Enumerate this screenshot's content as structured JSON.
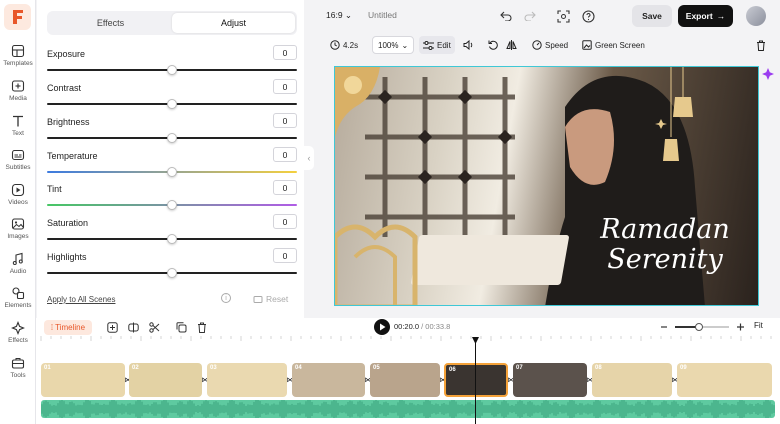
{
  "rail": {
    "items": [
      {
        "label": "Templates",
        "icon": "grid-icon"
      },
      {
        "label": "Media",
        "icon": "media-icon"
      },
      {
        "label": "Text",
        "icon": "text-icon"
      },
      {
        "label": "Subtitles",
        "icon": "subtitles-icon"
      },
      {
        "label": "Videos",
        "icon": "video-icon"
      },
      {
        "label": "Images",
        "icon": "image-icon"
      },
      {
        "label": "Audio",
        "icon": "music-icon"
      },
      {
        "label": "Elements",
        "icon": "shapes-icon"
      },
      {
        "label": "Effects",
        "icon": "sparkle-icon"
      },
      {
        "label": "Tools",
        "icon": "toolbox-icon"
      }
    ]
  },
  "panel": {
    "tabs": [
      "Effects",
      "Adjust"
    ],
    "active_tab": "Adjust",
    "adjustments": [
      {
        "name": "Exposure",
        "value": "0",
        "level": 0.5,
        "track": "#222222"
      },
      {
        "name": "Contrast",
        "value": "0",
        "level": 0.5,
        "track": "#222222"
      },
      {
        "name": "Brightness",
        "value": "0",
        "level": 0.5,
        "track": "#222222"
      },
      {
        "name": "Temperature",
        "value": "0",
        "level": 0.5,
        "track": "gradient-temp"
      },
      {
        "name": "Tint",
        "value": "0",
        "level": 0.5,
        "track": "gradient-tint"
      },
      {
        "name": "Saturation",
        "value": "0",
        "level": 0.5,
        "track": "#222222"
      },
      {
        "name": "Highlights",
        "value": "0",
        "level": 0.5,
        "track": "#222222"
      }
    ],
    "apply_all": "Apply to All Scenes",
    "reset": "Reset"
  },
  "topbar": {
    "ratio": "16:9",
    "title": "Untitled",
    "save": "Save",
    "export": "Export"
  },
  "toolbar": {
    "duration": "4.2s",
    "zoom": "100%",
    "edit": "Edit",
    "speed": "Speed",
    "green_screen": "Green Screen"
  },
  "canvas": {
    "line1": "Ramadan",
    "line2": "Serenity"
  },
  "timeline": {
    "tab": "Timeline",
    "current_time": "00:20.0",
    "total_time": "00:33.8",
    "fit": "Fit",
    "clips": [
      "01",
      "02",
      "03",
      "04",
      "05",
      "06",
      "07",
      "08",
      "09"
    ],
    "selected_clip": "06"
  },
  "colors": {
    "accent": "#e8572a",
    "selection": "#3fc8d6",
    "audio": "#5ecaa0"
  }
}
